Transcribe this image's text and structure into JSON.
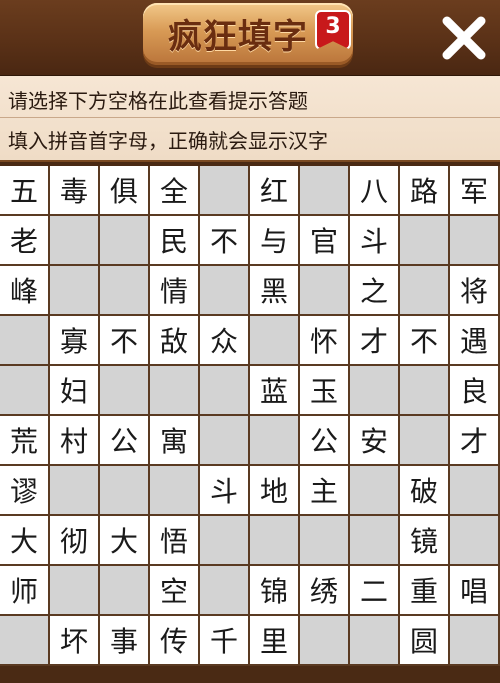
{
  "header": {
    "title": "疯狂填字",
    "level_badge": "3",
    "close_icon": "close-x-icon"
  },
  "hints": {
    "line1": "请选择下方空格在此查看提示答题",
    "line2": "填入拼音首字母，正确就会显示汉字"
  },
  "colors": {
    "header_wood": "#5a3117",
    "plaque": "#d89a55",
    "badge": "#c8191b",
    "cell_filled": "#ffffff",
    "cell_blank": "#d3d3d3",
    "grid_line": "#5a3a22"
  },
  "grid": {
    "rows": [
      [
        "五",
        "毒",
        "俱",
        "全",
        "",
        "红",
        "",
        "八",
        "路",
        "军"
      ],
      [
        "老",
        "",
        "",
        "民",
        "不",
        "与",
        "官",
        "斗",
        "",
        ""
      ],
      [
        "峰",
        "",
        "",
        "情",
        "",
        "黑",
        "",
        "之",
        "",
        "将"
      ],
      [
        "",
        "寡",
        "不",
        "敌",
        "众",
        "",
        "怀",
        "才",
        "不",
        "遇"
      ],
      [
        "",
        "妇",
        "",
        "",
        "",
        "蓝",
        "玉",
        "",
        "",
        "良"
      ],
      [
        "荒",
        "村",
        "公",
        "寓",
        "",
        "",
        "公",
        "安",
        "",
        "才"
      ],
      [
        "谬",
        "",
        "",
        "",
        "斗",
        "地",
        "主",
        "",
        "破",
        ""
      ],
      [
        "大",
        "彻",
        "大",
        "悟",
        "",
        "",
        "",
        "",
        "镜",
        ""
      ],
      [
        "师",
        "",
        "",
        "空",
        "",
        "锦",
        "绣",
        "二",
        "重",
        "唱"
      ],
      [
        "",
        "坏",
        "事",
        "传",
        "千",
        "里",
        "",
        "",
        "圆",
        ""
      ]
    ],
    "white_cells": [
      [
        1,
        1,
        1,
        1,
        0,
        1,
        0,
        1,
        1,
        1
      ],
      [
        1,
        0,
        0,
        1,
        1,
        1,
        1,
        1,
        0,
        0
      ],
      [
        1,
        0,
        0,
        1,
        0,
        1,
        0,
        1,
        0,
        1
      ],
      [
        0,
        1,
        1,
        1,
        1,
        0,
        1,
        1,
        1,
        1
      ],
      [
        0,
        1,
        0,
        0,
        0,
        1,
        1,
        0,
        0,
        1
      ],
      [
        1,
        1,
        1,
        1,
        0,
        0,
        1,
        1,
        0,
        1
      ],
      [
        1,
        0,
        0,
        0,
        1,
        1,
        1,
        0,
        1,
        0
      ],
      [
        1,
        1,
        1,
        1,
        0,
        0,
        0,
        0,
        1,
        0
      ],
      [
        1,
        0,
        0,
        1,
        0,
        1,
        1,
        1,
        1,
        1
      ],
      [
        0,
        1,
        1,
        1,
        1,
        1,
        0,
        0,
        1,
        0
      ]
    ]
  }
}
